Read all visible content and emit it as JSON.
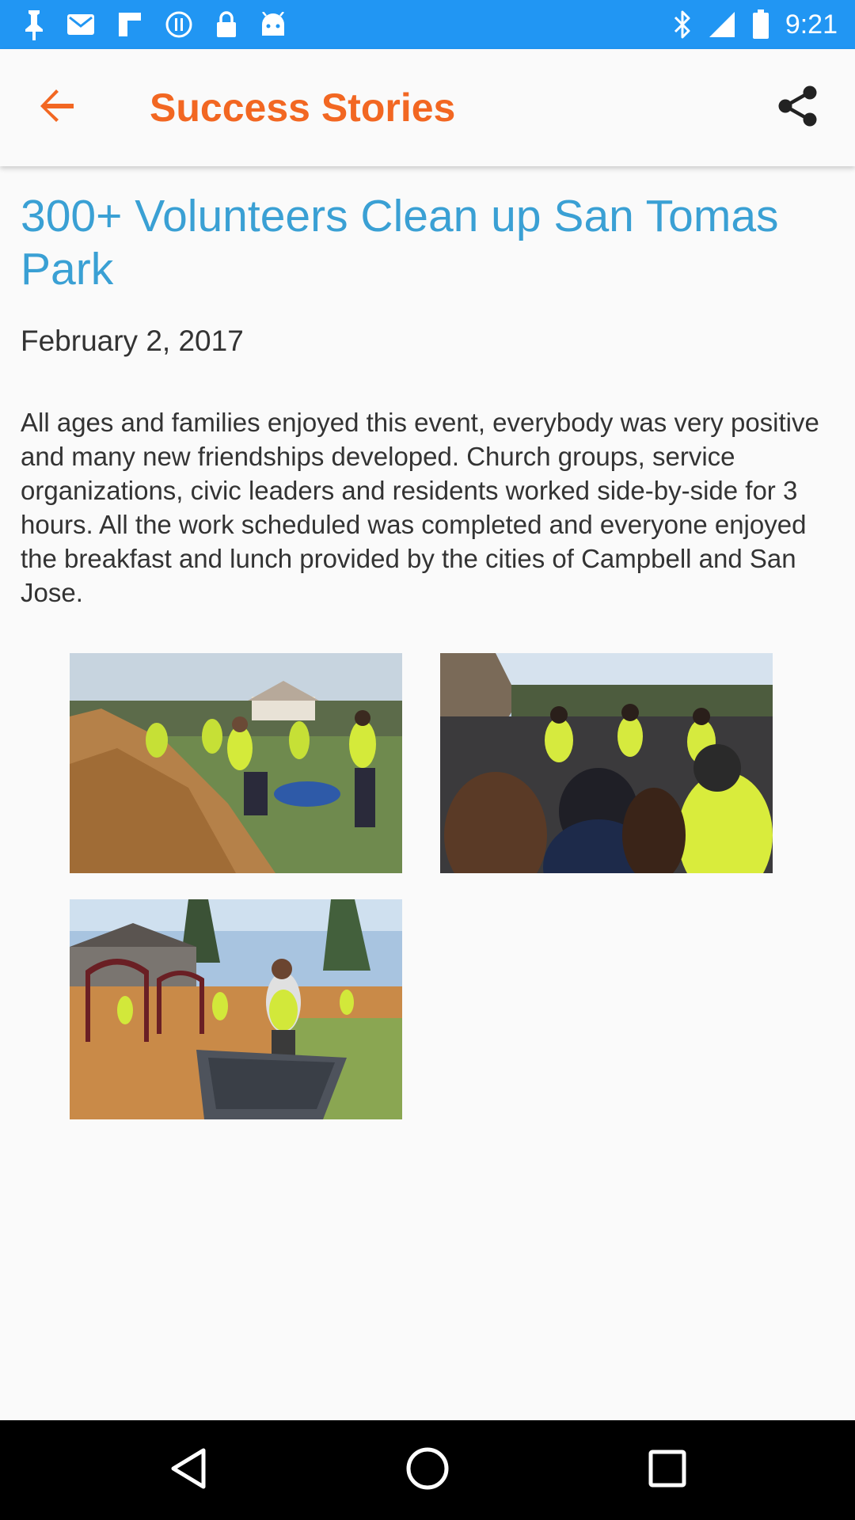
{
  "status_bar": {
    "time": "9:21",
    "color": "#2196f3",
    "left_icons": [
      "notification-pin-icon",
      "gmail-icon",
      "flipboard-icon",
      "data-saver-icon",
      "lock-icon",
      "android-icon"
    ],
    "right_icons": [
      "bluetooth-icon",
      "signal-icon",
      "battery-icon"
    ]
  },
  "app_bar": {
    "title": "Success Stories",
    "title_color": "#f26722",
    "back_icon": "arrow-back-icon",
    "share_icon": "share-icon"
  },
  "article": {
    "title": "300+ Volunteers Clean up San Tomas Park",
    "title_color": "#3aa0d4",
    "date": "February 2, 2017",
    "body": "All ages and families enjoyed this event, everybody was very positive and many new friendships developed. Church groups, service organizations, civic leaders and residents worked side-by-side for 3 hours. All the work scheduled was completed and everyone enjoyed the breakfast and lunch provided by the cities of Campbell and San Jose.",
    "photos": [
      {
        "subject": "volunteers-shoveling-mulch"
      },
      {
        "subject": "volunteers-gathered-crowd"
      },
      {
        "subject": "volunteer-with-wheelbarrow-playground"
      }
    ]
  },
  "nav_bar": {
    "buttons": [
      "nav-back-icon",
      "nav-home-icon",
      "nav-recents-icon"
    ]
  }
}
